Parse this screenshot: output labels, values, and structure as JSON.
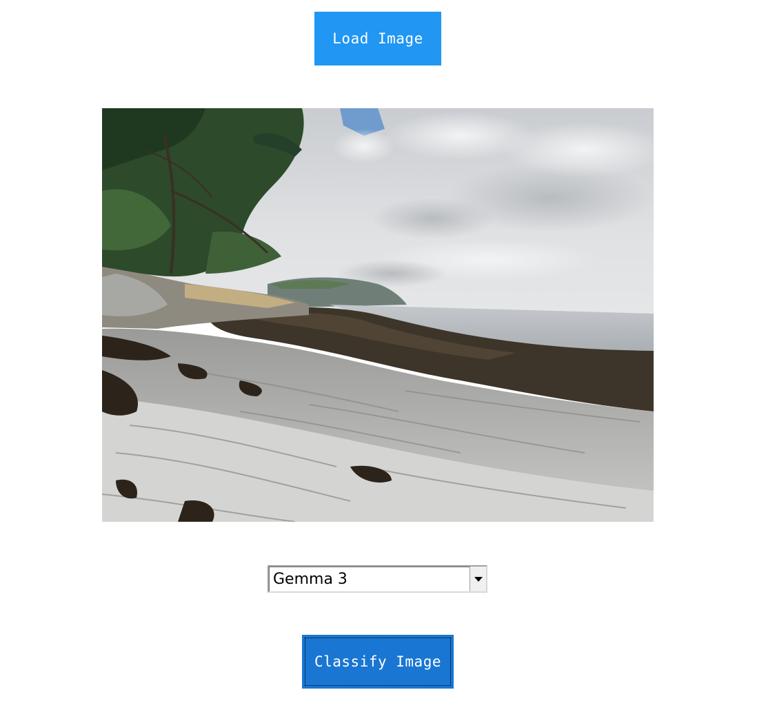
{
  "load_button": {
    "label": "Load Image"
  },
  "image": {
    "alt": "Rocky seashore with trees, cloudy sky and a distant headland over the sea"
  },
  "model_select": {
    "selected": "Gemma 3"
  },
  "classify_button": {
    "label": "Classify Image"
  },
  "colors": {
    "load_button_bg": "#2196f3",
    "classify_button_bg": "#1976d2",
    "page_bg": "#ffffff"
  },
  "icons": {
    "dropdown": "chevron-down-icon"
  }
}
